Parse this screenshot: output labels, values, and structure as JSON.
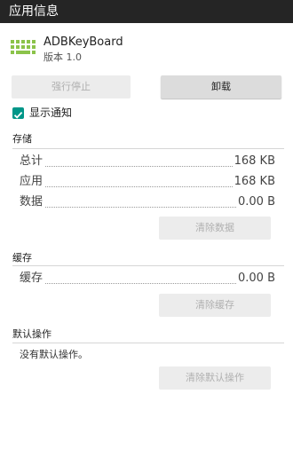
{
  "header": {
    "title": "应用信息"
  },
  "app": {
    "name": "ADBKeyBoard",
    "version": "版本 1.0"
  },
  "actions": {
    "force_stop": "强行停止",
    "uninstall": "卸载"
  },
  "notifications": {
    "label": "显示通知",
    "checked": true
  },
  "storage": {
    "title": "存储",
    "rows": [
      {
        "label": "总计",
        "value": "168 KB"
      },
      {
        "label": "应用",
        "value": "168 KB"
      },
      {
        "label": "数据",
        "value": "0.00 B"
      }
    ],
    "clear_button": "清除数据"
  },
  "cache": {
    "title": "缓存",
    "row": {
      "label": "缓存",
      "value": "0.00 B"
    },
    "clear_button": "清除缓存"
  },
  "defaults": {
    "title": "默认操作",
    "text": "没有默认操作。",
    "clear_button": "清除默认操作"
  },
  "colors": {
    "header_bg": "#252525",
    "accent": "#009688",
    "icon": "#8bc34a"
  }
}
